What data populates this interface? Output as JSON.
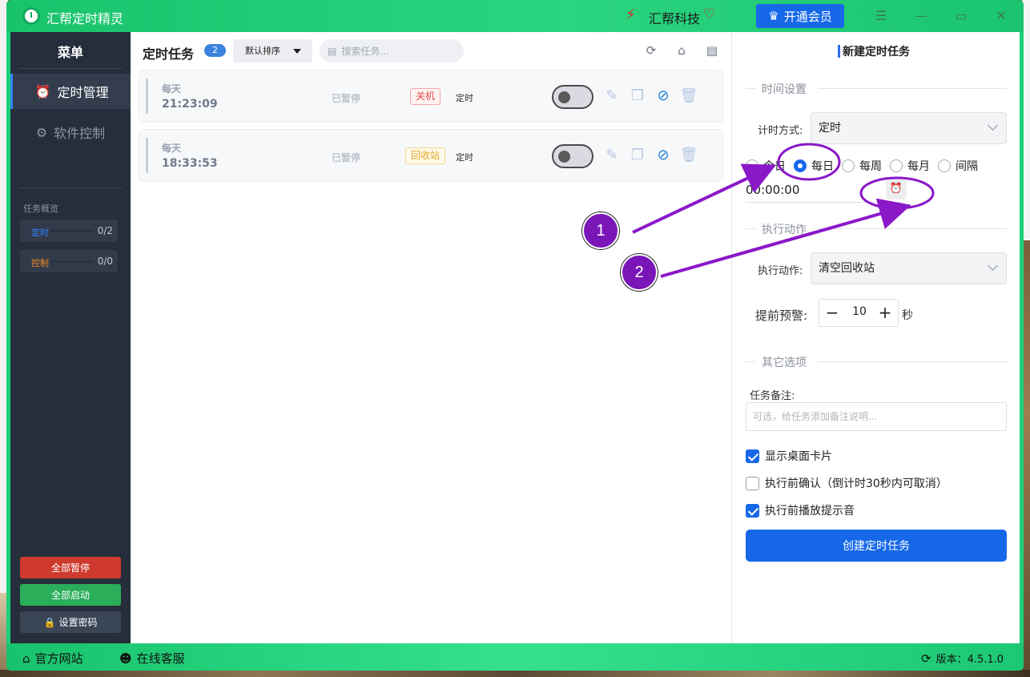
{
  "titlebar": {
    "app_title": "汇帮定时精灵",
    "brand_name": "汇帮科技",
    "vip_label": "开通会员"
  },
  "sidebar": {
    "menu_title": "菜单",
    "nav": [
      {
        "label": "定时管理",
        "icon": "alarm-clock-icon"
      },
      {
        "label": "软件控制",
        "icon": "gear-icon"
      }
    ],
    "overview_title": "任务概览",
    "overview": [
      {
        "label": "定时",
        "value": "0/2",
        "color": "#2f86ff"
      },
      {
        "label": "控制",
        "value": "0/0",
        "color": "#f08a24"
      }
    ],
    "buttons": {
      "pause_all": "全部暂停",
      "start_all": "全部启动",
      "set_password": "设置密码"
    }
  },
  "task_list": {
    "title": "定时任务",
    "count": "2",
    "sort": "默认排序",
    "search_placeholder": "搜索任务...",
    "tasks": [
      {
        "frequency": "每天",
        "time": "21:23:09",
        "status": "已暂停",
        "tag": "关机",
        "type": "定时",
        "enabled": false
      },
      {
        "frequency": "每天",
        "time": "18:33:53",
        "status": "已暂停",
        "tag": "回收站",
        "type": "定时",
        "enabled": false
      }
    ]
  },
  "form": {
    "title": "新建定时任务",
    "time_section": "时间设置",
    "timing_mode_label": "计时方式:",
    "timing_mode_value": "定时",
    "repeat_options": [
      "今日",
      "每日",
      "每周",
      "每月",
      "间隔"
    ],
    "repeat_selected": "每日",
    "time_value": "00:00:00",
    "action_section": "执行动作",
    "action_label": "执行动作:",
    "action_value": "清空回收站",
    "warning_label": "提前预警:",
    "warning_value": "10",
    "warning_unit": "秒",
    "other_section": "其它选项",
    "note_label": "任务备注:",
    "note_placeholder": "可选，给任务添加备注说明...",
    "checkboxes": [
      {
        "label": "显示桌面卡片",
        "checked": true
      },
      {
        "label": "执行前确认（倒计时30秒内可取消）",
        "checked": false
      },
      {
        "label": "执行前播放提示音",
        "checked": true
      }
    ],
    "create_button": "创建定时任务"
  },
  "statusbar": {
    "website": "官方网站",
    "support": "在线客服",
    "version": "版本：4.5.1.0"
  },
  "annotations": {
    "marker_1": "1",
    "marker_2": "2",
    "color": "#8a18c8"
  }
}
